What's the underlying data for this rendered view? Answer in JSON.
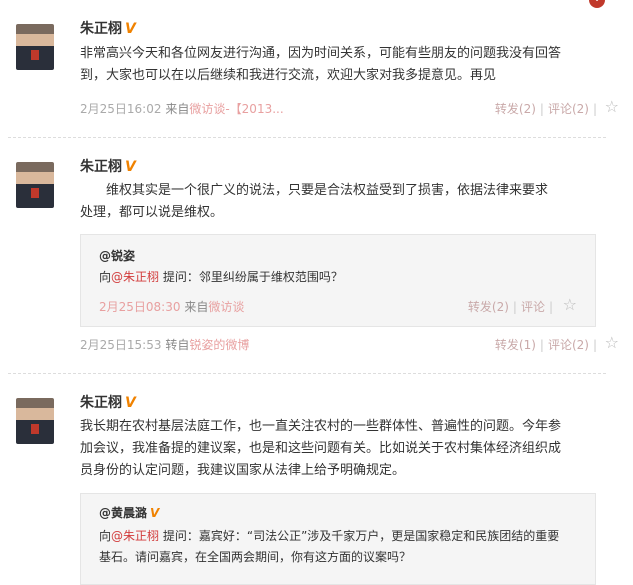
{
  "posts": [
    {
      "author": "朱正栩",
      "verified_badge": "V",
      "text_line1": "非常高兴今天和各位网友进行沟通，因为时间关系，可能有些朋友的问题我没有回答",
      "text_line2": "到，大家也可以在以后继续和我进行交流，欢迎大家对我多提意见。再见",
      "time": "2月25日16:02",
      "source_label": "来自",
      "source": "微访谈-【2013...",
      "repost": "转发(2)",
      "comment": "评论(2)"
    },
    {
      "author": "朱正栩",
      "verified_badge": "V",
      "text_line1": "　　维权其实是一个很广义的说法，只要是合法权益受到了损害，依据法律来要求",
      "text_line2": "处理，都可以说是维权。",
      "quote": {
        "author": "@锐姿",
        "prefix": "向",
        "mention": "@朱正栩",
        "question": " 提问：邻里纠纷属于维权范围吗？",
        "time": "2月25日08:30",
        "source_label": "来自",
        "source": "微访谈",
        "repost": "转发(2)",
        "comment": "评论"
      },
      "time": "2月25日15:53",
      "source_label": "转自",
      "source": "锐姿的微博",
      "repost": "转发(1)",
      "comment": "评论(2)"
    },
    {
      "author": "朱正栩",
      "verified_badge": "V",
      "text_line1": "我长期在农村基层法庭工作，也一直关注农村的一些群体性、普遍性的问题。今年参",
      "text_line2": "加会议，我准备提的建议案，也是和这些问题有关。比如说关于农村集体经济组织成",
      "text_line3": "员身份的认定问题，我建议国家从法律上给予明确规定。",
      "quote": {
        "author": "@黄晨潞",
        "verified_badge": "V",
        "prefix": "向",
        "mention": "@朱正栩",
        "question_line1": " 提问：嘉宾好：“司法公正”涉及千家万户，更是国家稳定和民族团结的重要",
        "question_line2": "基石。请问嘉宾，在全国两会期间，你有这方面的议案吗？"
      }
    }
  ],
  "icons": {
    "star": "☆",
    "collapse": "⌄"
  },
  "separator": "|"
}
